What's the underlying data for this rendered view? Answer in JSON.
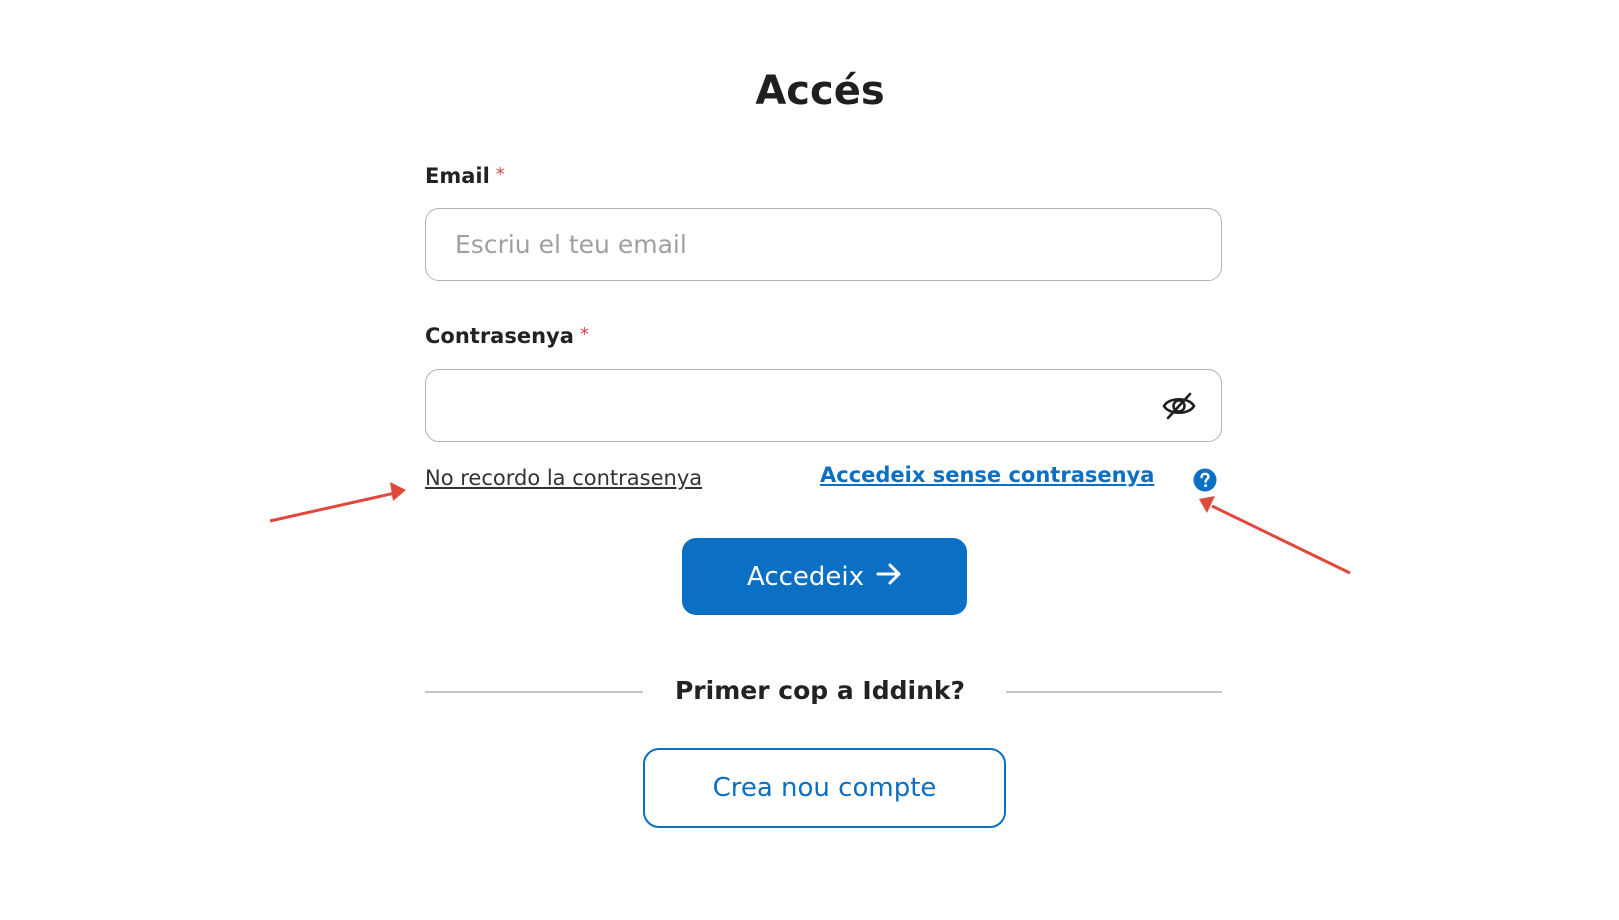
{
  "page": {
    "title": "Accés"
  },
  "email": {
    "label": "Email",
    "required_mark": "*",
    "placeholder": "Escriu el teu email",
    "value": ""
  },
  "password": {
    "label": "Contrasenya",
    "required_mark": "*",
    "value": "",
    "toggle_icon": "eye-slash-icon"
  },
  "links": {
    "forgot_password": "No recordo la contrasenya",
    "passwordless": "Accedeix sense contrasenya",
    "help_icon": "question-circle-icon"
  },
  "submit": {
    "label": "Accedeix",
    "icon": "arrow-right-icon"
  },
  "signup": {
    "divider_text": "Primer cop a Iddink?",
    "button_label": "Crea nou compte"
  },
  "colors": {
    "primary": "#0b6fc3",
    "required": "#d64545",
    "annotation_arrow": "#e0483b",
    "text": "#222222"
  }
}
